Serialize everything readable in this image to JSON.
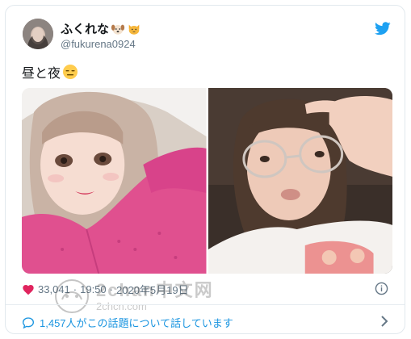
{
  "tweet": {
    "display_name": "ふくれな",
    "name_emojis": [
      "dog-face-emoji",
      "cat-face-emoji"
    ],
    "handle": "@fukurena0924",
    "text": "昼と夜",
    "text_emoji": "expressionless-face-emoji",
    "likes": "33,041",
    "time": "19:50",
    "date": "2020年5月19日",
    "discussion": "1,457人がこの話題について話しています"
  },
  "media": [
    {
      "name": "day-photo"
    },
    {
      "name": "night-photo"
    }
  ],
  "watermark": {
    "cn": "2chan中文网",
    "en": "2chcn.com"
  },
  "colors": {
    "twitter_blue": "#1da1f2",
    "link_blue": "#1b95e0",
    "heart_red": "#e0245e",
    "muted": "#657786",
    "border": "#e1e8ed"
  },
  "icons": {
    "logo": "twitter-bird-icon",
    "like": "heart-icon",
    "info": "info-icon",
    "discussion": "speech-bubble-icon",
    "more": "chevron-right-icon"
  }
}
